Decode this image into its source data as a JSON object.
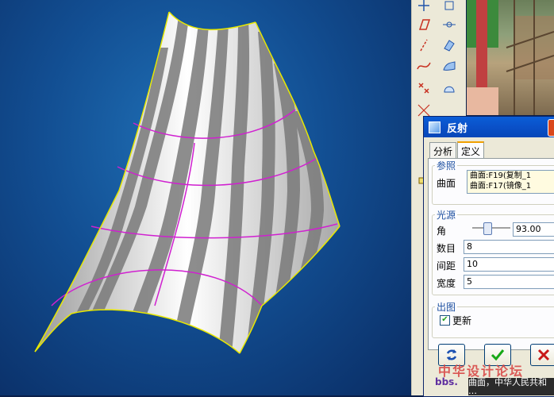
{
  "dialog": {
    "title": "反射",
    "tabs": [
      {
        "label": "分析",
        "active": false
      },
      {
        "label": "定义",
        "active": true
      }
    ],
    "reference": {
      "group_title": "参照",
      "surface_label": "曲面",
      "surfaces": [
        "曲面:F19(复制_1",
        "曲面:F17(镜像_1"
      ]
    },
    "light": {
      "group_title": "光源",
      "angle_label": "角",
      "angle_value": "93.00",
      "count_label": "数目",
      "count_value": "8",
      "spacing_label": "间距",
      "spacing_value": "10",
      "width_label": "宽度",
      "width_value": "5"
    },
    "output": {
      "group_title": "出图",
      "update_label": "更新",
      "update_checked": true
    }
  },
  "watermark": {
    "line1": "中华设计论坛",
    "line2": "bbs."
  },
  "status_text": "曲面，中华人民共和 …",
  "colors": {
    "viewport_bg": "#124e92",
    "curve": "#d020d0",
    "edge": "#e8e800",
    "accent": "#0a50c8"
  },
  "icons": [
    "point-icon",
    "parallelogram-icon",
    "line-icon",
    "curve-icon",
    "datum-point-icon",
    "datum-axis-icon",
    "datum-plane-icon",
    "surface-icon"
  ]
}
